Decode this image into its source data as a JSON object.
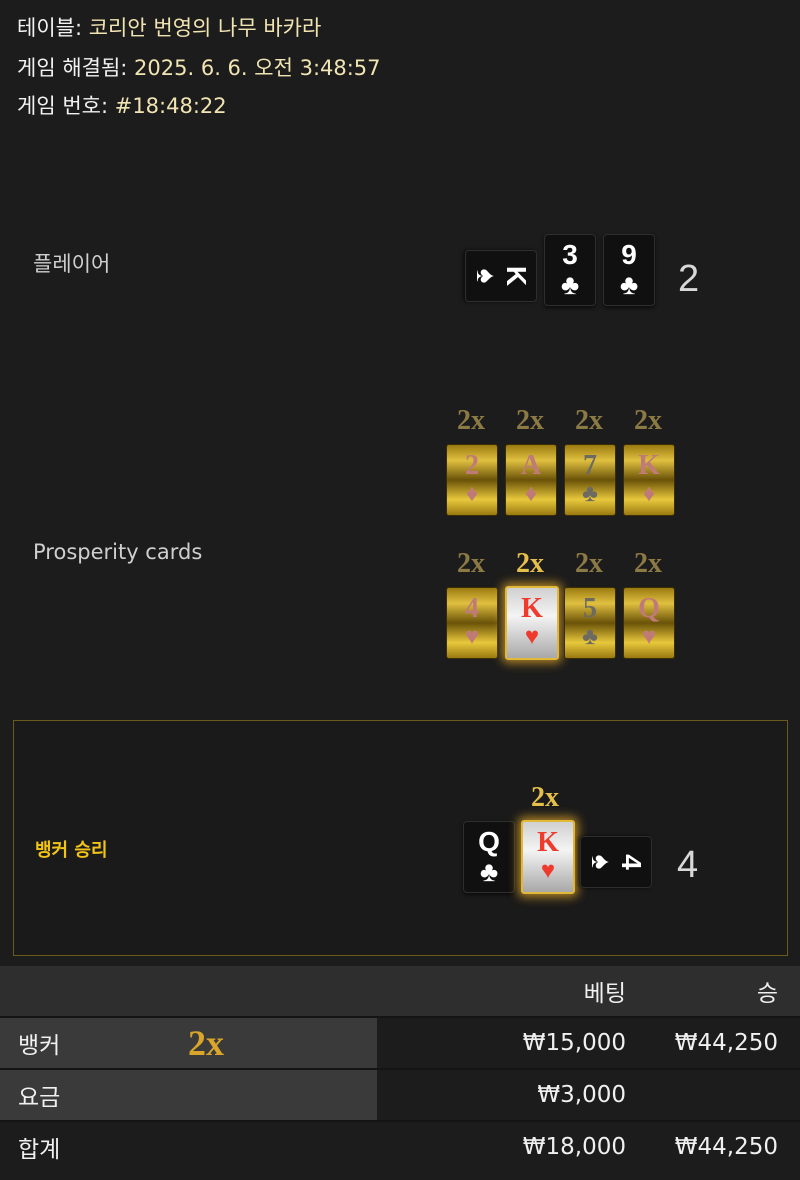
{
  "info": {
    "table_label": "테이블:",
    "table_value": "코리안 번영의 나무 바카라",
    "resolved_label": "게임 해결됨:",
    "resolved_value": "2025. 6. 6. 오전 3:48:57",
    "number_label": "게임 번호:",
    "number_value": "#18:48:22"
  },
  "player": {
    "label": "플레이어",
    "cards": [
      {
        "rank": "K",
        "suit": "♠"
      },
      {
        "rank": "3",
        "suit": "♣"
      },
      {
        "rank": "9",
        "suit": "♣"
      }
    ],
    "score": "2"
  },
  "prosperity": {
    "label": "Prosperity cards",
    "rows": [
      [
        {
          "mult": "2x",
          "rank": "2",
          "suit": "♦"
        },
        {
          "mult": "2x",
          "rank": "A",
          "suit": "♦"
        },
        {
          "mult": "2x",
          "rank": "7",
          "suit": "♣"
        },
        {
          "mult": "2x",
          "rank": "K",
          "suit": "♦"
        }
      ],
      [
        {
          "mult": "2x",
          "rank": "4",
          "suit": "♥"
        },
        {
          "mult": "2x",
          "rank": "K",
          "suit": "♥"
        },
        {
          "mult": "2x",
          "rank": "5",
          "suit": "♣"
        },
        {
          "mult": "2x",
          "rank": "Q",
          "suit": "♥"
        }
      ]
    ]
  },
  "banker": {
    "label": "뱅커 승리",
    "multiplier": "2x",
    "cards": [
      {
        "rank": "Q",
        "suit": "♣"
      },
      {
        "rank": "K",
        "suit": "♥"
      },
      {
        "rank": "4",
        "suit": "♠"
      }
    ],
    "score": "4"
  },
  "bets": {
    "col_bet": "베팅",
    "col_win": "승",
    "rows": [
      {
        "label": "뱅커",
        "multiplier": "2x",
        "bet": "₩15,000",
        "win": "₩44,250"
      },
      {
        "label": "요금",
        "bet": "₩3,000",
        "win": ""
      },
      {
        "label": "합계",
        "bet": "₩18,000",
        "win": "₩44,250"
      }
    ]
  }
}
